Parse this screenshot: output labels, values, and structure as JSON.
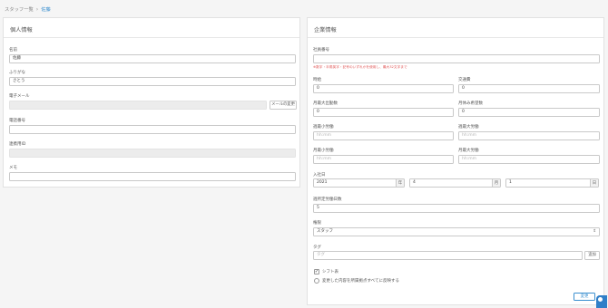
{
  "breadcrumb": {
    "parent": "スタッフ一覧",
    "current": "佐藤"
  },
  "personal": {
    "title": "個人情報",
    "name_label": "名前",
    "name_value": "佐藤",
    "kana_label": "ふりがな",
    "kana_value": "さとう",
    "email_label": "電子メール",
    "email_value": "",
    "email_change_button": "メールの変更",
    "phone_label": "電話番号",
    "phone_value": "",
    "linked_id_label": "連携用ID",
    "linked_id_value": "",
    "memo_label": "メモ",
    "memo_value": ""
  },
  "company": {
    "title": "企業情報",
    "employee_no_label": "社員番号",
    "employee_no_value": "",
    "employee_no_note": "※数字・半角英字・記号のいずれかを使用し、最大32文字まで",
    "hourly_label": "時給",
    "hourly_value": "0",
    "transport_label": "交通費",
    "transport_value": "0",
    "monthly_max_days_label": "月最大出勤数",
    "monthly_max_days_value": "0",
    "monthly_off_days_label": "月休み希望数",
    "monthly_off_days_value": "0",
    "weekly_min_hours_label": "週最小労働",
    "weekly_min_hours_placeholder": "hh:mm",
    "weekly_max_hours_label": "週最大労働",
    "weekly_max_hours_placeholder": "hh:mm",
    "monthly_min_hours_label": "月最小労働",
    "monthly_min_hours_placeholder": "hh:mm",
    "monthly_max_hours_label": "月最大労働",
    "monthly_max_hours_placeholder": "hh:mm",
    "join_date_label": "入社日",
    "join_year": "2021",
    "join_year_unit": "年",
    "join_month": "4",
    "join_month_unit": "月",
    "join_day": "1",
    "join_day_unit": "日",
    "weekly_days_label": "週所定労働日数",
    "weekly_days_value": "5",
    "role_label": "権限",
    "role_value": "スタッフ",
    "tag_label": "タグ",
    "tag_placeholder": "タグ",
    "tag_add_button": "追加",
    "shift_check_label": "シフト表",
    "shift_check_mark": "✓",
    "apply_all_label": "変更した内容を所属拠点すべてに反映する",
    "save_button": "変更"
  },
  "colors": {
    "accent": "#3a8fcf",
    "note": "#e05555",
    "fab": "#2f7fc8"
  }
}
